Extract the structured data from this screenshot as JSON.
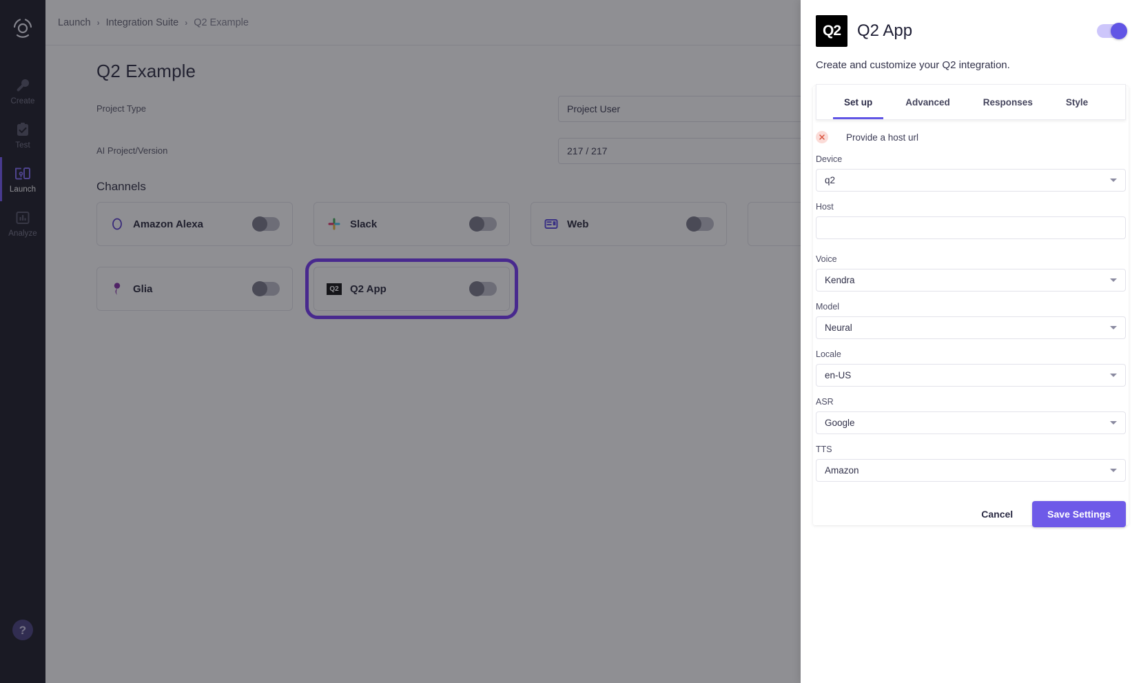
{
  "sidebar": {
    "logo_icon": "aperture-logo-icon",
    "items": [
      {
        "label": "Create",
        "icon": "wrench-icon",
        "active": false
      },
      {
        "label": "Test",
        "icon": "clipboard-check-icon",
        "active": false
      },
      {
        "label": "Launch",
        "icon": "devices-icon",
        "active": true
      },
      {
        "label": "Analyze",
        "icon": "bar-chart-icon",
        "active": false
      }
    ],
    "help_label": "?",
    "active_accent": "#6c4ff6"
  },
  "breadcrumb": {
    "items": [
      "Launch",
      "Integration Suite",
      "Q2 Example"
    ],
    "separator": "›"
  },
  "page": {
    "title": "Q2 Example",
    "fields": [
      {
        "label": "Project Type",
        "value": "Project User"
      },
      {
        "label": "AI Project/Version",
        "value": "217 / 217"
      }
    ],
    "channels_heading": "Channels",
    "channels": [
      {
        "name": "Amazon Alexa",
        "icon": "amazon-alexa-icon",
        "enabled": false,
        "highlighted": false
      },
      {
        "name": "Slack",
        "icon": "slack-icon",
        "enabled": false,
        "highlighted": false
      },
      {
        "name": "Web",
        "icon": "web-icon",
        "enabled": false,
        "highlighted": false
      },
      {
        "name": "",
        "icon": "partial-card-icon",
        "enabled": false,
        "highlighted": false
      },
      {
        "name": "Glia",
        "icon": "glia-icon",
        "enabled": false,
        "highlighted": false
      },
      {
        "name": "Q2 App",
        "icon": "q2-icon",
        "enabled": false,
        "highlighted": true
      }
    ],
    "highlight_color": "#6c2bf5"
  },
  "panel": {
    "logo_text": "Q2",
    "title": "Q2 App",
    "enabled_toggle": true,
    "subtitle": "Create and customize your Q2 integration.",
    "tabs": [
      {
        "label": "Set up",
        "active": true
      },
      {
        "label": "Advanced",
        "active": false
      },
      {
        "label": "Responses",
        "active": false
      },
      {
        "label": "Style",
        "active": false
      }
    ],
    "error": {
      "icon": "error-x-icon",
      "text": "Provide a host url"
    },
    "fields": [
      {
        "label": "Device",
        "value": "q2",
        "type": "select",
        "placeholder": ""
      },
      {
        "label": "Host",
        "value": "",
        "type": "input",
        "placeholder": ""
      },
      {
        "label": "Voice",
        "value": "Kendra",
        "type": "select",
        "placeholder": ""
      },
      {
        "label": "Model",
        "value": "Neural",
        "type": "select",
        "placeholder": ""
      },
      {
        "label": "Locale",
        "value": "en-US",
        "type": "select",
        "placeholder": ""
      },
      {
        "label": "ASR",
        "value": "Google",
        "type": "select",
        "placeholder": ""
      },
      {
        "label": "TTS",
        "value": "Amazon",
        "type": "select",
        "placeholder": ""
      }
    ],
    "cancel_label": "Cancel",
    "save_label": "Save Settings",
    "accent": "#6e5ae8"
  }
}
